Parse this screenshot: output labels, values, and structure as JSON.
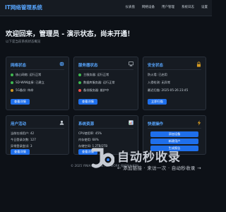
{
  "header": {
    "brand": "IT网络管理系统",
    "nav": [
      "仪表盘",
      "网络设备",
      "用户管理",
      "系统日志",
      "设置"
    ]
  },
  "welcome": {
    "title": "欢迎回来，管理员 - 演示状态，尚未开通！",
    "subtitle": "以下是当前系统状态概览"
  },
  "cards": {
    "network": {
      "title": "网络状态",
      "lines": [
        "核心网络: 运行正常",
        "SD-WAN连接: 已建立",
        "5G备份: 待命"
      ],
      "button": "查看详情",
      "icon": "globe-icon"
    },
    "server": {
      "title": "服务器状态",
      "lines": [
        "主服务器: 运行正常",
        "数据库服务器: 运行正常",
        "备份服务器: 维护中"
      ],
      "button": "查看详情",
      "icon": "monitor-icon"
    },
    "security": {
      "title": "安全状态",
      "lines": [
        "防火墙: 已启用",
        "入侵检测: 无异常",
        "最近扫描: 2025-05-26 23:45"
      ],
      "button": "立即扫描",
      "icon": "lock-icon"
    },
    "users": {
      "title": "用户活动",
      "lines": [
        "当前在线用户: 42",
        "今日登录次数: 127",
        "异常登录尝试: 3"
      ],
      "button": "查看详情",
      "icon": "user-icon"
    },
    "resources": {
      "title": "系统资源",
      "lines": [
        "CPU使用率: 45%",
        "内存使用: 68%",
        "存储空间: 1.2TB/2TB"
      ],
      "button": "查看详情",
      "icon": "chart-icon"
    },
    "quick": {
      "title": "快速操作",
      "buttons": [
        "添加设备",
        "新建用户",
        "生成报告"
      ],
      "icon": "lightning-icon"
    }
  },
  "footer": {
    "text": "© 2025 YINIA RESURE NETWORK 保留所有权利。"
  },
  "watermark": {
    "title": "自动秒收录",
    "subtitle": "← 添加链接 · 来访一次 · 自动秒收录 →"
  },
  "colors": {
    "green": "#3fb950",
    "yellow": "#d29922",
    "red": "#f85149",
    "blue": "#58a6ff",
    "accent": "#1f6feb"
  }
}
